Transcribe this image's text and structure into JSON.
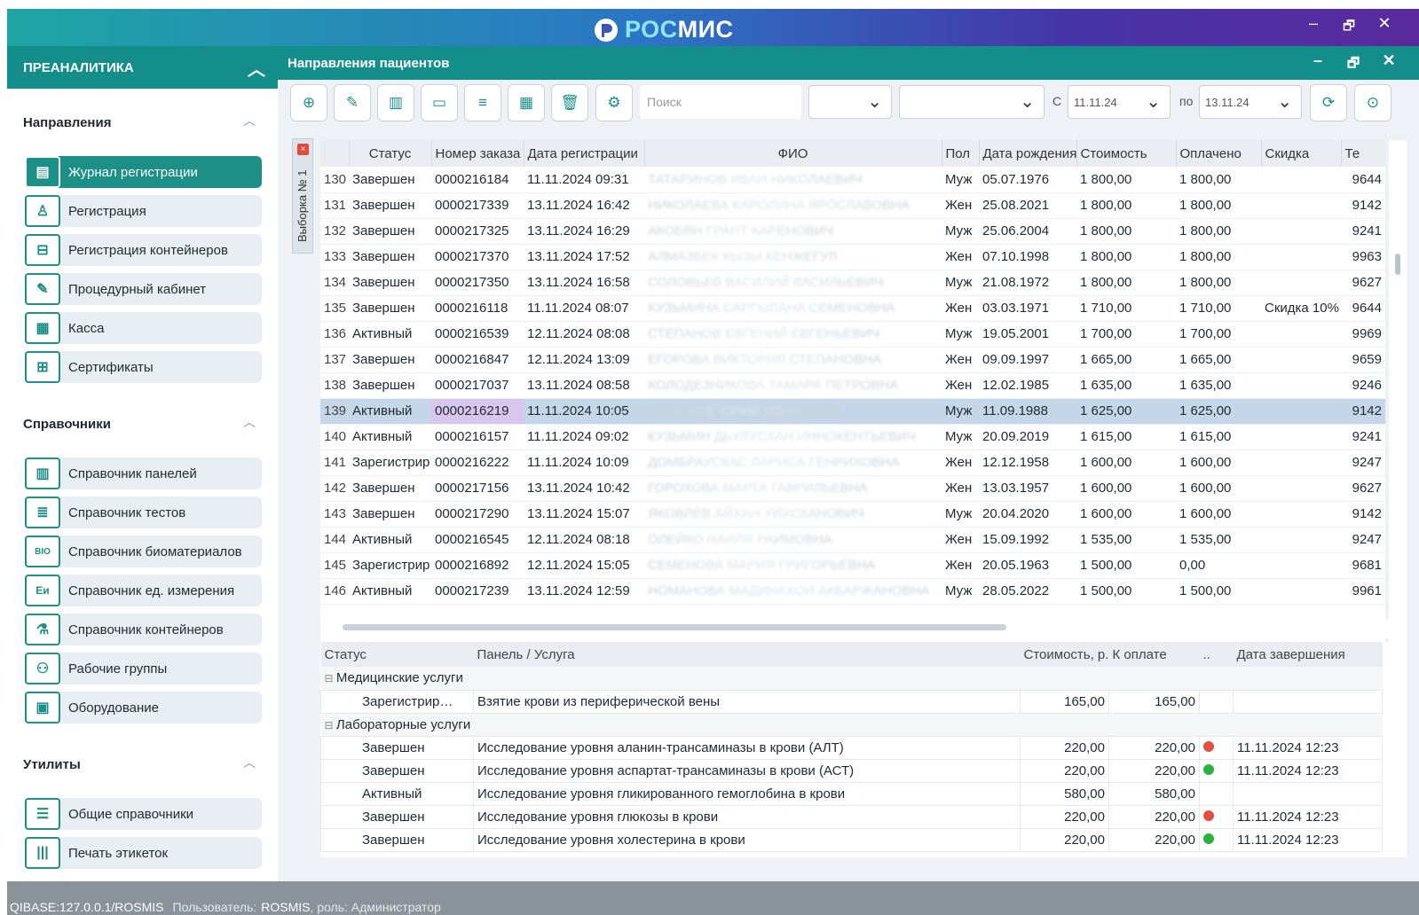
{
  "app": {
    "brand_prefix": "РОС",
    "brand_suffix": "МИС",
    "minimize": "–",
    "restore": "🗗",
    "close": "✕"
  },
  "sidebar": {
    "header": "ПРЕАНАЛИТИКА",
    "sections": [
      {
        "title": "Направления",
        "items": [
          "Журнал регистрации",
          "Регистрация",
          "Регистрация контейнеров",
          "Процедурный кабинет",
          "Касса",
          "Сертификаты"
        ]
      },
      {
        "title": "Справочники",
        "items": [
          "Справочник панелей",
          "Справочник тестов",
          "Справочник биоматериалов",
          "Справочник ед. измерения",
          "Справочник контейнеров",
          "Рабочие группы",
          "Оборудование"
        ]
      },
      {
        "title": "Утилиты",
        "items": [
          "Общие справочники",
          "Печать этикеток"
        ]
      }
    ],
    "icons": {
      "journal": "journal-icon",
      "registration": "add-person-icon",
      "containers": "container-icon",
      "procedure": "syringe-icon",
      "cash": "cash-register-icon",
      "certificates": "gift-icon",
      "panels": "panels-icon",
      "tests": "tests-icon",
      "biomaterials": "bio-icon",
      "units": "units-icon",
      "containers_ref": "flask-icon",
      "groups": "group-icon",
      "equipment": "equipment-icon",
      "general": "list-icon",
      "labels": "barcode-icon"
    }
  },
  "panel": {
    "title": "Направления пациентов"
  },
  "toolbar": {
    "search_placeholder": "Поиск",
    "from_label": "С",
    "from_date": "11.11.24",
    "to_label": "по",
    "to_date": "13.11.24"
  },
  "vtab": {
    "label": "Выборка № 1",
    "close": "×"
  },
  "grid": {
    "columns": [
      "",
      "Статус",
      "Номер заказа",
      "Дата регистрации",
      "ФИО",
      "Пол",
      "Дата рождения",
      "Стоимость",
      "Оплачено",
      "Скидка",
      "Те"
    ],
    "rows": [
      [
        "130",
        "Завершен",
        "0000216184",
        "11.11.2024 09:31",
        "ТАТАРИНОВ ИВАН НИКОЛАЕВИЧ",
        "Муж",
        "05.07.1976",
        "1 800,00",
        "1 800,00",
        "",
        "9644"
      ],
      [
        "131",
        "Завершен",
        "0000217339",
        "13.11.2024 16:42",
        "НИКОЛАЕВА КАРОЛИНА ЯРОСЛАВОВНА",
        "Жен",
        "25.08.2021",
        "1 800,00",
        "1 800,00",
        "",
        "9142"
      ],
      [
        "132",
        "Завершен",
        "0000217325",
        "13.11.2024 16:29",
        "АКОБЯН ГРАНТ КАРЕНОВИЧ",
        "Муж",
        "25.06.2004",
        "1 800,00",
        "1 800,00",
        "",
        "9241"
      ],
      [
        "133",
        "Завершен",
        "0000217370",
        "13.11.2024 17:52",
        "АЛМАЗБЕК КЫЗЫ КЕНЖЕГУЛ",
        "Жен",
        "07.10.1998",
        "1 800,00",
        "1 800,00",
        "",
        "9963"
      ],
      [
        "134",
        "Завершен",
        "0000217350",
        "13.11.2024 16:58",
        "СОЛОВЬЕВ ВАСИЛИЙ ВАСИЛЬЕВИЧ",
        "Муж",
        "21.08.1972",
        "1 800,00",
        "1 800,00",
        "",
        "9627"
      ],
      [
        "135",
        "Завершен",
        "0000216118",
        "11.11.2024 08:07",
        "КУЗЬМИНА САРГЫЛАНА СЕМЕНОВНА",
        "Жен",
        "03.03.1971",
        "1 710,00",
        "1 710,00",
        "Скидка 10%",
        "9644"
      ],
      [
        "136",
        "Активный",
        "0000216539",
        "12.11.2024 08:08",
        "СТЕПАНОВ ЕВГЕНИЙ ЕВГЕНЬЕВИЧ",
        "Муж",
        "19.05.2001",
        "1 700,00",
        "1 700,00",
        "",
        "9969"
      ],
      [
        "137",
        "Завершен",
        "0000216847",
        "12.11.2024 13:09",
        "ЕГОРОВА ВИКТОРИЯ СТЕПАНОВНА",
        "Жен",
        "09.09.1997",
        "1 665,00",
        "1 665,00",
        "",
        "9659"
      ],
      [
        "138",
        "Завершен",
        "0000217037",
        "13.11.2024 08:58",
        "КОЛОДЕЗНИКОВА ТАМАРА ПЕТРОВНА",
        "Жен",
        "12.02.1985",
        "1 635,00",
        "1 635,00",
        "",
        "9246"
      ],
      [
        "139",
        "Активный",
        "0000216219",
        "11.11.2024 10:05",
        "СЕМЕНОВ ЮРИЙ ИВАНОВИЧ",
        "Муж",
        "11.09.1988",
        "1 625,00",
        "1 625,00",
        "",
        "9142"
      ],
      [
        "140",
        "Активный",
        "0000216157",
        "11.11.2024 09:02",
        "КУЗЬМИН ДЬУЛУСХАН ИННОКЕНТЬЕВИЧ",
        "Муж",
        "20.09.2019",
        "1 615,00",
        "1 615,00",
        "",
        "9241"
      ],
      [
        "141",
        "Зарегистрир",
        "0000216222",
        "11.11.2024 10:09",
        "ДОМБРАУСКАС ЛАРИСА ГЕНРИХОВНА",
        "Жен",
        "12.12.1958",
        "1 600,00",
        "1 600,00",
        "",
        "9247"
      ],
      [
        "142",
        "Завершен",
        "0000217156",
        "13.11.2024 10:42",
        "ГОРОХОВА МАРТА ГАВРИЛЬЕВНА",
        "Жен",
        "13.03.1957",
        "1 600,00",
        "1 600,00",
        "",
        "9627"
      ],
      [
        "143",
        "Завершен",
        "0000217290",
        "13.11.2024 15:07",
        "ЯКОВЛЕВ АЙХАН УЙУСХАНОВИЧ",
        "Муж",
        "20.04.2020",
        "1 600,00",
        "1 600,00",
        "",
        "9142"
      ],
      [
        "144",
        "Активный",
        "0000216545",
        "12.11.2024 08:18",
        "ОЛЕЙКО НАИЛЯ РАИМОВНА",
        "Жен",
        "15.09.1992",
        "1 535,00",
        "1 535,00",
        "",
        "9247"
      ],
      [
        "145",
        "Зарегистрир",
        "0000216892",
        "12.11.2024 15:05",
        "СЕМЕНОВА МАРИЯ ГРИГОРЬЕВНА",
        "Жен",
        "20.05.1963",
        "1 500,00",
        "0,00",
        "",
        "9681"
      ],
      [
        "146",
        "Активный",
        "0000217239",
        "13.11.2024 12:59",
        "НОМАНОВА МАДИНАХОН АКБАРЖАНОВНА",
        "Муж",
        "28.05.2022",
        "1 500,00",
        "1 500,00",
        "",
        "9961"
      ]
    ],
    "selected_row": 9
  },
  "detail": {
    "columns": [
      "Статус",
      "Панель / Услуга",
      "Стоимость, р.",
      "К оплате",
      "..",
      "Дата завершения"
    ],
    "groups": [
      {
        "name": "Медицинские услуги",
        "rows": [
          {
            "status": "Зарегистрир…",
            "service": "Взятие крови из периферической вены",
            "cost": "165,00",
            "pay": "165,00",
            "dot": "",
            "date": ""
          }
        ]
      },
      {
        "name": "Лабораторные услуги",
        "rows": [
          {
            "status": "Завершен",
            "service": "Исследование уровня аланин-трансаминазы в крови (АЛТ)",
            "cost": "220,00",
            "pay": "220,00",
            "dot": "red",
            "date": "11.11.2024 12:23"
          },
          {
            "status": "Завершен",
            "service": "Исследование уровня аспартат-трансаминазы в крови (АСТ)",
            "cost": "220,00",
            "pay": "220,00",
            "dot": "green",
            "date": "11.11.2024 12:23"
          },
          {
            "status": "Активный",
            "service": "Исследование уровня гликированного гемоглобина в крови",
            "cost": "580,00",
            "pay": "580,00",
            "dot": "",
            "date": ""
          },
          {
            "status": "Завершен",
            "service": "Исследование уровня глюкозы в крови",
            "cost": "220,00",
            "pay": "220,00",
            "dot": "red",
            "date": "11.11.2024 12:23"
          },
          {
            "status": "Завершен",
            "service": "Исследование уровня холестерина в крови",
            "cost": "220,00",
            "pay": "220,00",
            "dot": "green",
            "date": "11.11.2024 12:23"
          }
        ]
      }
    ],
    "colors": {
      "red": "#e0503e",
      "green": "#2ab33c"
    }
  },
  "status": {
    "db": "QIBASE:127.0.0.1/ROSMIS",
    "user_label": "Пользователь:",
    "user": "ROSMIS",
    "role": ", роль: Администратор"
  }
}
